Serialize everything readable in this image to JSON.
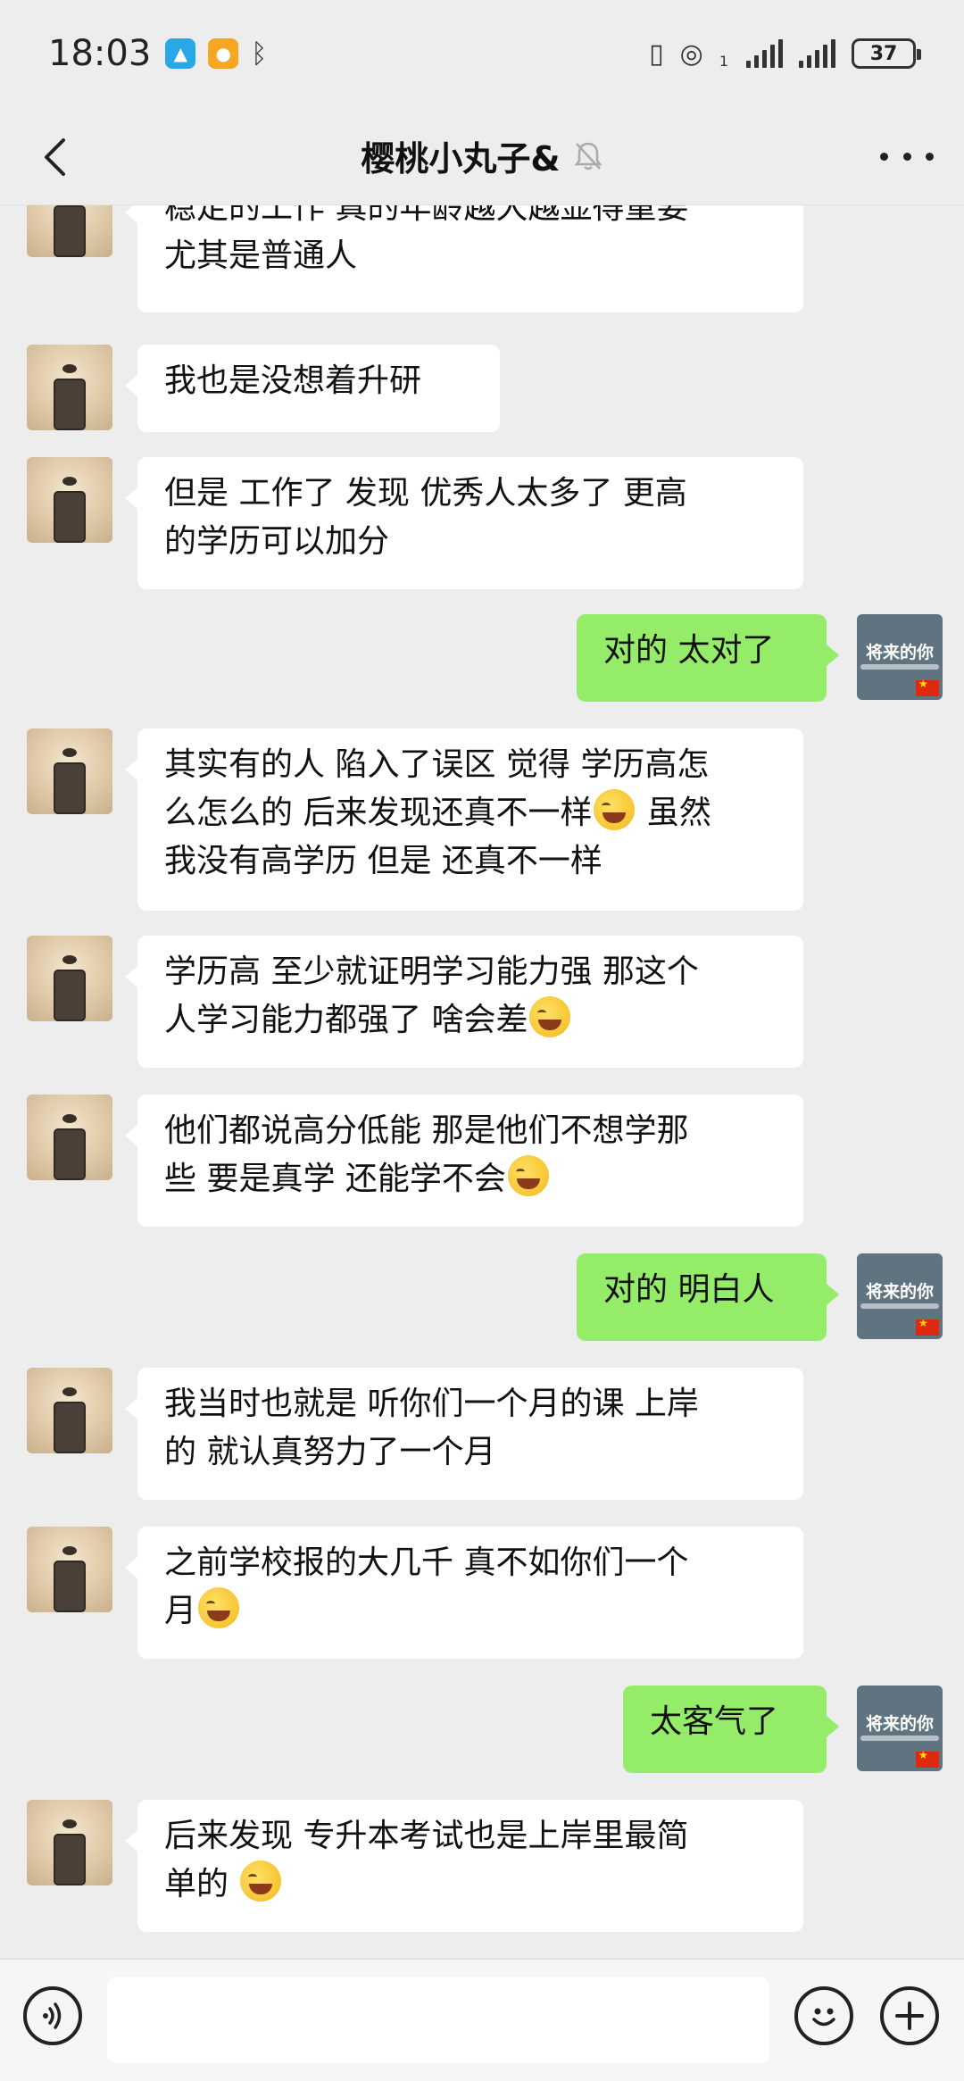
{
  "status_bar": {
    "time": "18:03",
    "battery": "37",
    "signal_sim1_label": "1",
    "icons": [
      "app-badge-icon",
      "app-badge-icon",
      "bluetooth-icon",
      "vibrate-icon",
      "hotspot-icon",
      "signal-icon",
      "battery-icon"
    ]
  },
  "header": {
    "title": "樱桃小丸子&",
    "mute_icon": "bell-muted-icon",
    "back_icon": "chevron-left-icon",
    "more_icon": "more-dots-icon"
  },
  "contacts": {
    "self_avatar_text": "将来的你"
  },
  "messages": [
    {
      "side": "in",
      "parts": [
        "稳定的工作 真的年龄越大越显得重要\n尤其是普通人"
      ]
    },
    {
      "side": "in",
      "parts": [
        "我也是没想着升研"
      ]
    },
    {
      "side": "in",
      "parts": [
        "但是 工作了 发现 优秀人太多了 更高\n的学历可以加分"
      ]
    },
    {
      "side": "out",
      "parts": [
        "对的 太对了"
      ]
    },
    {
      "side": "in",
      "parts": [
        "其实有的人 陷入了误区 觉得 学历高怎\n么怎么的 后来发现还真不一样",
        "[emoji]",
        " 虽然\n我没有高学历 但是 还真不一样"
      ]
    },
    {
      "side": "in",
      "parts": [
        "学历高 至少就证明学习能力强 那这个\n人学习能力都强了 啥会差",
        "[emoji]"
      ]
    },
    {
      "side": "in",
      "parts": [
        "他们都说高分低能 那是他们不想学那\n些 要是真学 还能学不会",
        "[emoji]"
      ]
    },
    {
      "side": "out",
      "parts": [
        "对的 明白人"
      ]
    },
    {
      "side": "in",
      "parts": [
        "我当时也就是 听你们一个月的课 上岸\n的 就认真努力了一个月"
      ]
    },
    {
      "side": "in",
      "parts": [
        "之前学校报的大几千 真不如你们一个\n月",
        "[emoji]"
      ]
    },
    {
      "side": "out",
      "parts": [
        "太客气了"
      ]
    },
    {
      "side": "in",
      "parts": [
        "后来发现 专升本考试也是上岸里最简\n单的 ",
        "[emoji]"
      ]
    }
  ],
  "input_bar": {
    "voice_icon": "voice-icon",
    "emoji_icon": "emoji-face-icon",
    "plus_icon": "plus-icon",
    "input_value": ""
  },
  "colors": {
    "background": "#ededed",
    "incoming_bubble": "#ffffff",
    "outgoing_bubble": "#95ec69"
  }
}
